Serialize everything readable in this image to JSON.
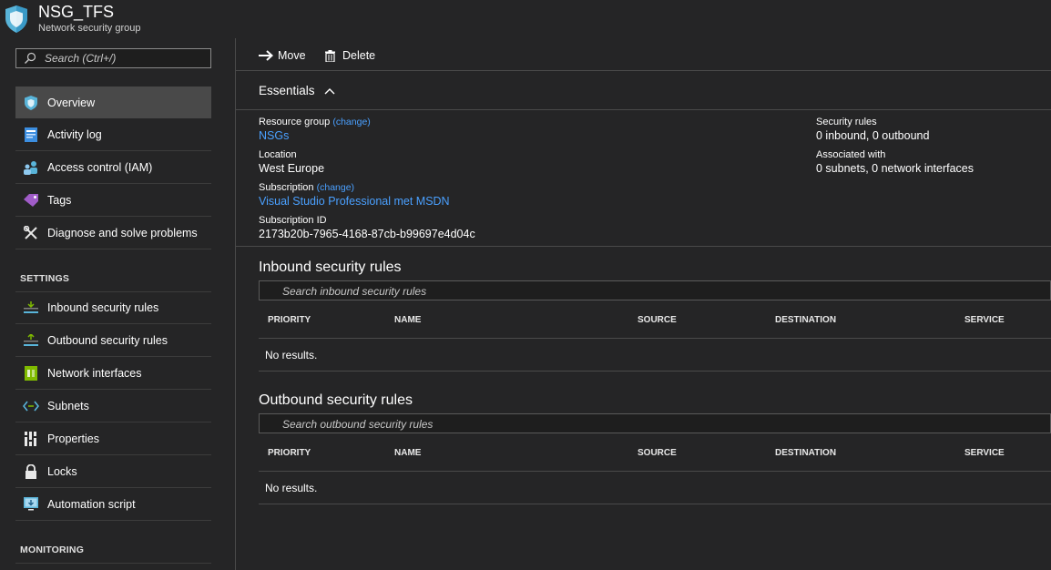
{
  "header": {
    "title": "NSG_TFS",
    "subtitle": "Network security group"
  },
  "sidebar": {
    "search_placeholder": "Search (Ctrl+/)",
    "items_top": [
      {
        "label": "Overview",
        "icon": "shield-icon",
        "active": true
      },
      {
        "label": "Activity log",
        "icon": "activity-log-icon"
      },
      {
        "label": "Access control (IAM)",
        "icon": "people-icon"
      },
      {
        "label": "Tags",
        "icon": "tag-icon"
      },
      {
        "label": "Diagnose and solve problems",
        "icon": "wrench-icon"
      }
    ],
    "settings_title": "SETTINGS",
    "settings_items": [
      {
        "label": "Inbound security rules",
        "icon": "inbound-rules-icon"
      },
      {
        "label": "Outbound security rules",
        "icon": "outbound-rules-icon"
      },
      {
        "label": "Network interfaces",
        "icon": "network-interface-icon"
      },
      {
        "label": "Subnets",
        "icon": "subnet-icon"
      },
      {
        "label": "Properties",
        "icon": "properties-icon"
      },
      {
        "label": "Locks",
        "icon": "lock-icon"
      },
      {
        "label": "Automation script",
        "icon": "automation-script-icon"
      }
    ],
    "monitoring_title": "MONITORING"
  },
  "toolbar": {
    "move_label": "Move",
    "delete_label": "Delete"
  },
  "essentials": {
    "title": "Essentials",
    "resource_group_label": "Resource group",
    "change_label": "(change)",
    "resource_group_value": "NSGs",
    "location_label": "Location",
    "location_value": "West Europe",
    "subscription_label": "Subscription",
    "subscription_value": "Visual Studio Professional met MSDN",
    "subscription_id_label": "Subscription ID",
    "subscription_id_value": "2173b20b-7965-4168-87cb-b99697e4d04c",
    "security_rules_label": "Security rules",
    "security_rules_value": "0 inbound, 0 outbound",
    "associated_label": "Associated with",
    "associated_value": "0 subnets, 0 network interfaces"
  },
  "inbound": {
    "title": "Inbound security rules",
    "search_placeholder": "Search inbound security rules",
    "columns": [
      "PRIORITY",
      "NAME",
      "SOURCE",
      "DESTINATION",
      "SERVICE"
    ],
    "empty_text": "No results."
  },
  "outbound": {
    "title": "Outbound security rules",
    "search_placeholder": "Search outbound security rules",
    "columns": [
      "PRIORITY",
      "NAME",
      "SOURCE",
      "DESTINATION",
      "SERVICE"
    ],
    "empty_text": "No results."
  },
  "colors": {
    "background": "#252526",
    "link": "#4aa0ff",
    "active_nav": "#494949",
    "divider": "#4a4a4a"
  }
}
